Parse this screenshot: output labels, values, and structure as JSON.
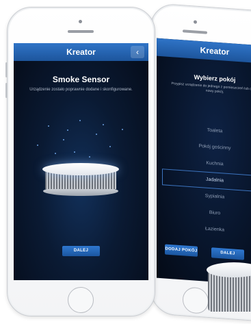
{
  "left_screen": {
    "title": "Kreator",
    "back_glyph": "‹",
    "heading": "Smoke Sensor",
    "message": "Urządzenie zostało poprawnie dodane i skonfigurowane.",
    "next_button": "DALEJ"
  },
  "right_screen": {
    "title": "Kreator",
    "back_glyph": "‹",
    "heading": "Wybierz pokój",
    "message": "Przypisz urządzenie do jednego z pomieszczeń lub dodaj nowy pokój.",
    "rooms": [
      {
        "label": "Toaleta",
        "selected": false
      },
      {
        "label": "Pokój gościnny",
        "selected": false
      },
      {
        "label": "Kuchnia",
        "selected": false
      },
      {
        "label": "Jadalnia",
        "selected": true
      },
      {
        "label": "Sypialnia",
        "selected": false
      },
      {
        "label": "Biuro",
        "selected": false
      },
      {
        "label": "Łazienka",
        "selected": false
      }
    ],
    "add_room_button": "DODAJ POKÓJ",
    "next_button": "DALEJ"
  },
  "colors": {
    "app_bar": "#2563b0",
    "screen_bg": "#07142a",
    "button": "#2467bb",
    "selection_border": "#3c74bf"
  },
  "icons": [
    "back-chevron-icon",
    "smoke-sensor-image"
  ]
}
